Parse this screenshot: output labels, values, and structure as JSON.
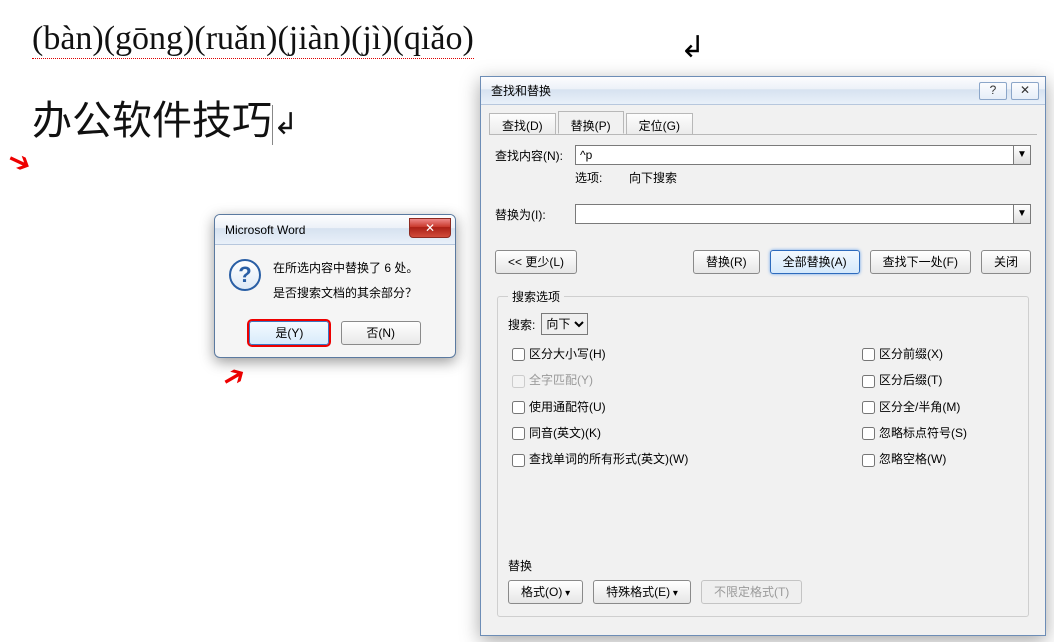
{
  "document": {
    "pinyin": "(bàn)(gōng)(ruǎn)(jiàn)(jì)(qiǎo)",
    "hanzi": "办公软件技巧"
  },
  "alert": {
    "title": "Microsoft Word",
    "msg1": "在所选内容中替换了 6 处。",
    "msg2": "是否搜索文档的其余部分？",
    "yes": "是(Y)",
    "no": "否(N)",
    "close": "✕"
  },
  "fr": {
    "title": "查找和替换",
    "help": "?",
    "close": "✕",
    "tab_find": "查找(D)",
    "tab_replace": "替换(P)",
    "tab_goto": "定位(G)",
    "find_label": "查找内容(N):",
    "find_value": "^p",
    "opt_label": "选项:",
    "opt_value": "向下搜索",
    "replace_label": "替换为(I):",
    "replace_value": "",
    "btn_less": "<< 更少(L)",
    "btn_replace": "替换(R)",
    "btn_replace_all": "全部替换(A)",
    "btn_find_next": "查找下一处(F)",
    "btn_close": "关闭",
    "fs_title": "搜索选项",
    "search_label": "搜索:",
    "search_value": "向下",
    "chk_case": "区分大小写(H)",
    "chk_whole": "全字匹配(Y)",
    "chk_wild": "使用通配符(U)",
    "chk_sound": "同音(英文)(K)",
    "chk_forms": "查找单词的所有形式(英文)(W)",
    "chk_prefix": "区分前缀(X)",
    "chk_suffix": "区分后缀(T)",
    "chk_fullhalf": "区分全/半角(M)",
    "chk_punct": "忽略标点符号(S)",
    "chk_space": "忽略空格(W)",
    "grp_replace": "替换",
    "btn_format": "格式(O)",
    "btn_special": "特殊格式(E)",
    "btn_noformat": "不限定格式(T)"
  }
}
